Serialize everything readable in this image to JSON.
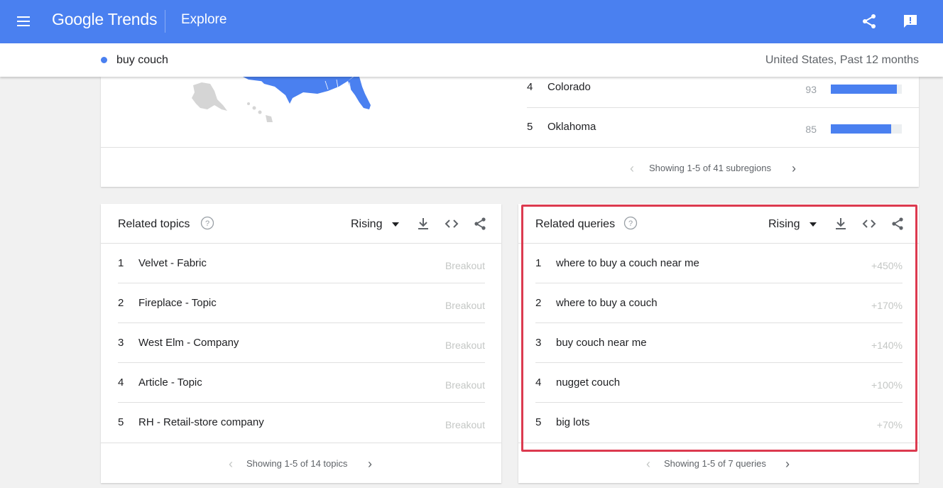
{
  "appbar": {
    "logo": "Google Trends",
    "page_title": "Explore",
    "icons": [
      "menu-icon",
      "share-icon",
      "feedback-icon"
    ],
    "color": "#4a80f0"
  },
  "search": {
    "term": "buy couch",
    "term_color": "#4a80f0",
    "meta": "United States, Past 12 months"
  },
  "subregions": {
    "rows": [
      {
        "rank": "4",
        "name": "Colorado",
        "value": "93",
        "score": 93
      },
      {
        "rank": "5",
        "name": "Oklahoma",
        "value": "85",
        "score": 85
      }
    ],
    "pager": "Showing 1-5 of 41 subregions"
  },
  "related_topics": {
    "title": "Related topics",
    "filter": "Rising",
    "rows": [
      {
        "rank": "1",
        "label": "Velvet - Fabric",
        "metric": "Breakout"
      },
      {
        "rank": "2",
        "label": "Fireplace - Topic",
        "metric": "Breakout"
      },
      {
        "rank": "3",
        "label": "West Elm - Company",
        "metric": "Breakout"
      },
      {
        "rank": "4",
        "label": "Article - Topic",
        "metric": "Breakout"
      },
      {
        "rank": "5",
        "label": "RH - Retail-store company",
        "metric": "Breakout"
      }
    ],
    "pager": "Showing 1-5 of 14 topics"
  },
  "related_queries": {
    "title": "Related queries",
    "filter": "Rising",
    "highlight_color": "#dc3a4f",
    "rows": [
      {
        "rank": "1",
        "label": "where to buy a couch near me",
        "metric": "+450%"
      },
      {
        "rank": "2",
        "label": "where to buy a couch",
        "metric": "+170%"
      },
      {
        "rank": "3",
        "label": "buy couch near me",
        "metric": "+140%"
      },
      {
        "rank": "4",
        "label": "nugget couch",
        "metric": "+100%"
      },
      {
        "rank": "5",
        "label": "big lots",
        "metric": "+70%"
      }
    ],
    "pager": "Showing 1-5 of 7 queries"
  }
}
